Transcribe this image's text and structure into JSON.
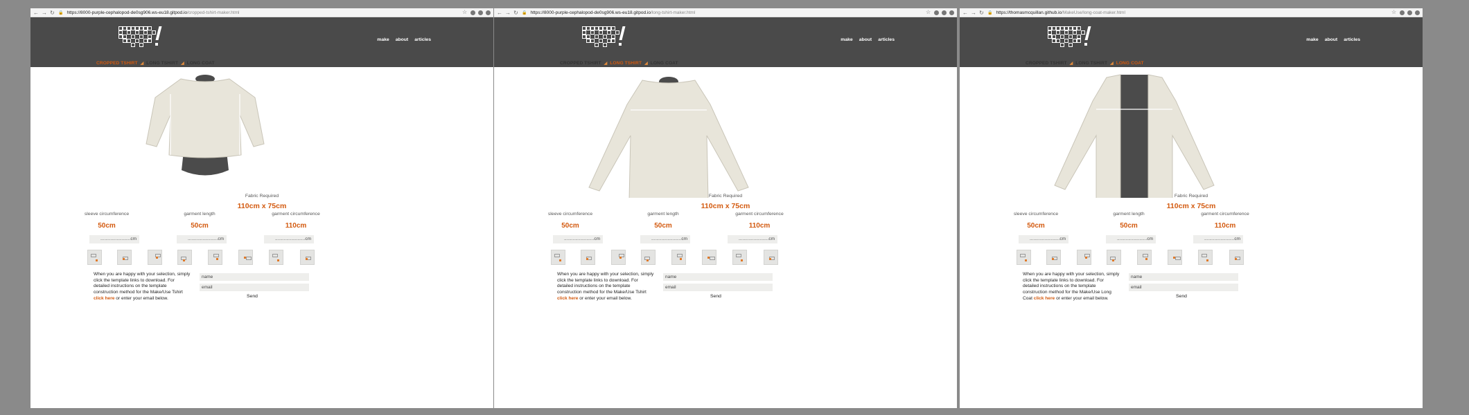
{
  "windows": [
    {
      "url_host": "https://8000-purple-cephalopod-de0sg906.ws-eu18.gitpod.io",
      "url_path": "/cropped-tshirt-maker.html",
      "active_crumb": 0,
      "garment": "cropped",
      "note_garment": "Tshirt"
    },
    {
      "url_host": "https://8000-purple-cephalopod-de0sg906.ws-eu18.gitpod.io",
      "url_path": "/long-tshirt-maker.html",
      "active_crumb": 1,
      "garment": "long",
      "note_garment": "Tshirt"
    },
    {
      "url_host": "https://thomasmcquillan.github.io",
      "url_path": "/MakeUse/long-coat-maker.html",
      "active_crumb": 2,
      "garment": "coat",
      "note_garment": "Long Coat"
    }
  ],
  "nav": {
    "make": "make",
    "about": "about",
    "articles": "articles"
  },
  "crumbs": [
    "CROPPED TSHIRT",
    "LONG TSHIRT",
    "LONG COAT"
  ],
  "crumb_separator": "◢",
  "fabric": {
    "label": "Fabric Required",
    "value": "110cm x 75cm"
  },
  "measurements": [
    {
      "label": "sleeve circumference",
      "value": "50cm"
    },
    {
      "label": "garment length",
      "value": "50cm"
    },
    {
      "label": "garment circumference",
      "value": "110cm"
    }
  ],
  "cm_input_text": "........................cm",
  "note": {
    "part1": "When you are happy with your selection, simply click the template links to download. For detailed instructions on the template construction method for the Make/Use",
    "link": "click here",
    "part2": "or enter your email below."
  },
  "form": {
    "name_placeholder": "name",
    "email_placeholder": "email",
    "send_label": "Send"
  },
  "colors": {
    "accent": "#d35a0f",
    "header": "#4a4a4a",
    "fabric": "#e8e5da",
    "lining": "#4b4b4b"
  },
  "icons": [
    "back-arrow-icon",
    "forward-arrow-icon",
    "reload-icon",
    "lock-icon",
    "star-icon",
    "extension-icon"
  ]
}
